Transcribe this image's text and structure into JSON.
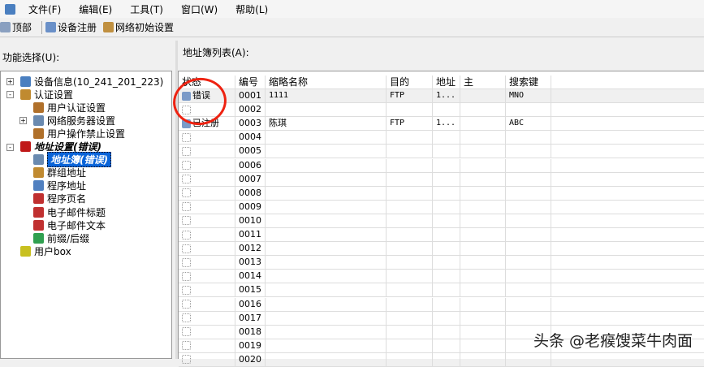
{
  "menu": [
    "文件(F)",
    "编辑(E)",
    "工具(T)",
    "窗口(W)",
    "帮助(L)"
  ],
  "toolbar": {
    "top": "顶部",
    "register": "设备注册",
    "network": "网络初始设置"
  },
  "left": {
    "label": "功能选择(U):",
    "tree": [
      {
        "label": "设备信息(10_241_201_223)",
        "level": 0,
        "pm": "+",
        "icon": "info-icon",
        "color": "#4a7fc0"
      },
      {
        "label": "认证设置",
        "level": 0,
        "pm": "-",
        "icon": "auth-settings-icon",
        "color": "#c08a30"
      },
      {
        "label": "用户认证设置",
        "level": 1,
        "icon": "user-icon",
        "color": "#b0702a"
      },
      {
        "label": "网络服务器设置",
        "level": 1,
        "pm": "+",
        "icon": "server-icon",
        "color": "#6a8ab0"
      },
      {
        "label": "用户操作禁止设置",
        "level": 1,
        "icon": "user-block-icon",
        "color": "#b0702a"
      },
      {
        "label": "地址设置(错误)",
        "level": 0,
        "pm": "-",
        "icon": "mailbox-icon",
        "color": "#c01818",
        "style": "bi"
      },
      {
        "label": "地址簿(错误)",
        "level": 1,
        "icon": "address-book-icon",
        "color": "#6a8ab0",
        "style": "sel"
      },
      {
        "label": "群组地址",
        "level": 1,
        "icon": "group-icon",
        "color": "#c08a30"
      },
      {
        "label": "程序地址",
        "level": 1,
        "icon": "program-icon",
        "color": "#5080c0"
      },
      {
        "label": "程序页名",
        "level": 1,
        "icon": "page-name-icon",
        "color": "#c03030"
      },
      {
        "label": "电子邮件标题",
        "level": 1,
        "icon": "email-title-icon",
        "color": "#c03030"
      },
      {
        "label": "电子邮件文本",
        "level": 1,
        "icon": "email-text-icon",
        "color": "#c03030"
      },
      {
        "label": "前缀/后缀",
        "level": 1,
        "icon": "prefix-suffix-icon",
        "color": "#30a050"
      },
      {
        "label": "用户box",
        "level": 0,
        "icon": "box-icon",
        "color": "#c8c020"
      }
    ]
  },
  "right": {
    "label": "地址簿列表(A):",
    "columns": [
      "状态",
      "编号",
      "缩略名称",
      "目的",
      "地址",
      "主",
      "搜索键",
      ""
    ],
    "rows": [
      [
        "错误",
        "0001",
        "1111",
        "FTP",
        "1...",
        "",
        "MNO"
      ],
      [
        "",
        "0002",
        "",
        "",
        "",
        "",
        ""
      ],
      [
        "已注册",
        "0003",
        "陈琪",
        "FTP",
        "1...",
        "",
        "ABC"
      ],
      [
        "",
        "0004"
      ],
      [
        "",
        "0005"
      ],
      [
        "",
        "0006"
      ],
      [
        "",
        "0007"
      ],
      [
        "",
        "0008"
      ],
      [
        "",
        "0009"
      ],
      [
        "",
        "0010"
      ],
      [
        "",
        "0011"
      ],
      [
        "",
        "0012"
      ],
      [
        "",
        "0013"
      ],
      [
        "",
        "0014"
      ],
      [
        "",
        "0015"
      ],
      [
        "",
        "0016"
      ],
      [
        "",
        "0017"
      ],
      [
        "",
        "0018"
      ],
      [
        "",
        "0019"
      ],
      [
        "",
        "0020"
      ]
    ]
  },
  "watermark": "头条 @老瘊馊菜牛肉面"
}
